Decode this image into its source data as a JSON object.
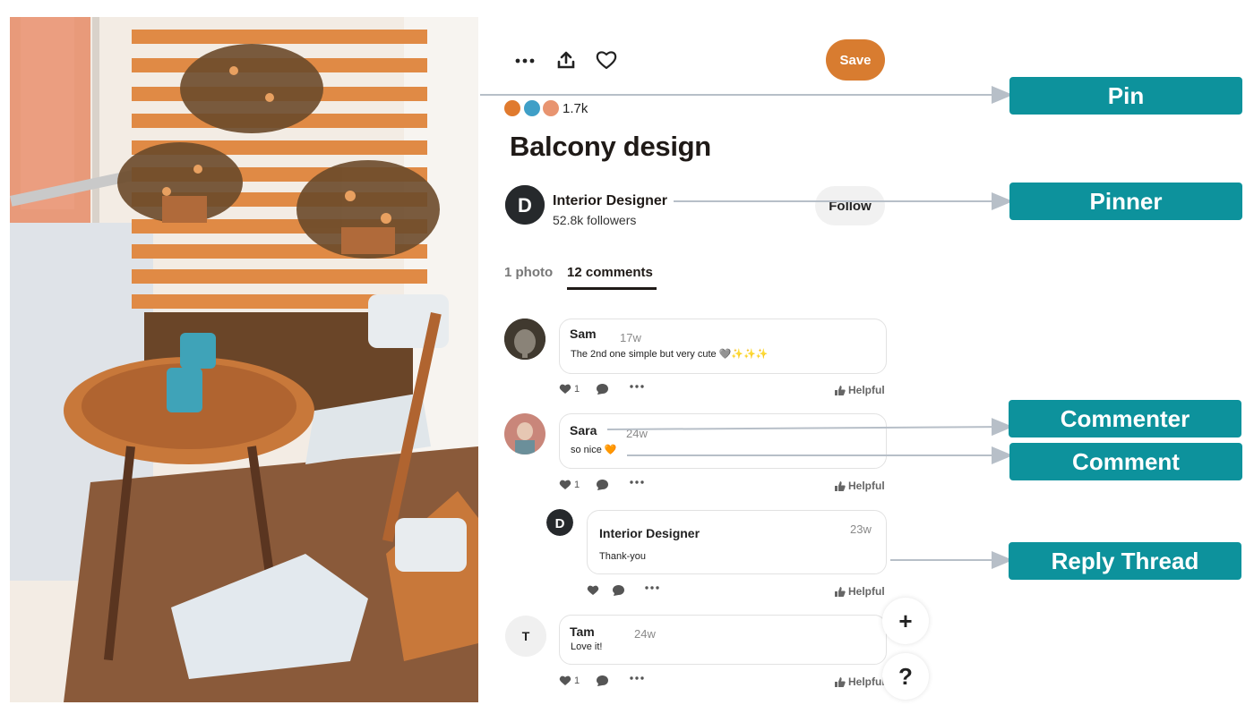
{
  "toolbar": {
    "more_icon": "more-horizontal-icon",
    "share_icon": "share-upload-icon",
    "like_icon": "heart-outline-icon",
    "save_label": "Save"
  },
  "colors": {
    "accent": "#d87c30",
    "callout": "#0d929c",
    "text_dark": "#1f1a17"
  },
  "pin": {
    "reactions": [
      "heart-reaction-icon",
      "laugh-reaction-icon",
      "wow-reaction-icon"
    ],
    "reaction_count": "1.7k",
    "title": "Balcony design"
  },
  "pinner": {
    "name": "Interior Designer",
    "followers": "52.8k followers",
    "follow_label": "Follow",
    "avatar_initial": "D"
  },
  "tabs": [
    {
      "label": "1 photo",
      "active": false
    },
    {
      "label": "12 comments",
      "active": true
    }
  ],
  "comments": [
    {
      "author": "Sam",
      "time": "17w",
      "text": "The 2nd one simple but very cute 🩶✨✨✨",
      "likes": "1",
      "helpful": "Helpful"
    },
    {
      "author": "Sara",
      "time": "24w",
      "text": "so nice 🧡",
      "likes": "1",
      "helpful": "Helpful"
    },
    {
      "author": "Interior Designer",
      "time": "23w",
      "text": "Thank-you",
      "likes": "",
      "helpful": "Helpful",
      "is_reply": true
    },
    {
      "author": "Tam",
      "time": "24w",
      "text": "Love it!",
      "likes": "1",
      "helpful": "Helpful",
      "avatar_initial": "T"
    }
  ],
  "fabs": {
    "add_label": "+",
    "help_label": "?"
  },
  "callouts": {
    "pin": "Pin",
    "pinner": "Pinner",
    "commenter": "Commenter",
    "comment": "Comment",
    "reply_thread": "Reply Thread"
  }
}
